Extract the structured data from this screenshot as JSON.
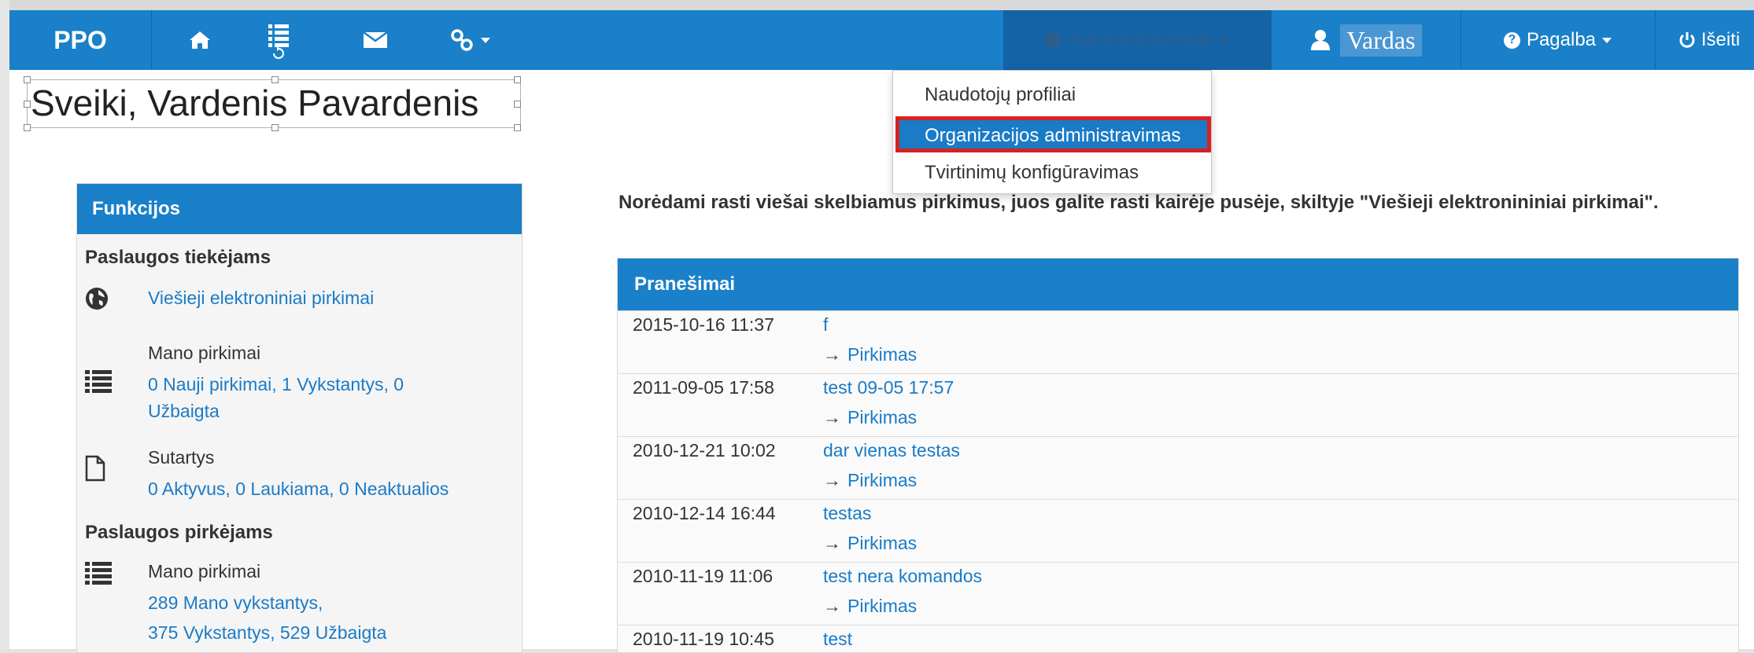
{
  "navbar": {
    "brand": "PPO",
    "home_icon": "home-icon",
    "list_icon": "list-icon",
    "mail_icon": "mail-icon",
    "links_icon": "link-icon",
    "admin_label": "Administravimas",
    "user_icon": "user-icon",
    "user_name": "Vardas",
    "help_icon": "question-circle-icon",
    "help_label": "Pagalba",
    "logout_icon": "power-icon",
    "logout_label": "Išeiti",
    "colors": {
      "bar": "#1a80c9",
      "active": "#1463a5"
    }
  },
  "greeting": "Sveiki, Vardenis Pavardenis",
  "dropdown": {
    "items": [
      {
        "label": "Naudotojų profiliai"
      },
      {
        "label": "Organizacijos administravimas",
        "active": true,
        "highlight_border": "#d62222"
      },
      {
        "label": "Tvirtinimų konfigūravimas"
      }
    ]
  },
  "notice": "Norėdami rasti viešai skelbiamus pirkimus, juos galite rasti kairėje pusėje, skiltyje \"Viešieji elektronininiai pirkimai\".",
  "functions": {
    "title": "Funkcijos",
    "suppliers_title": "Paslaugos tiekėjams",
    "public_link": "Viešieji elektroniniai pirkimai",
    "my_purchases_label": "Mano pirkimai",
    "my_purchases_line1": "0 Nauji pirkimai,  1 Vykstantys,  0",
    "my_purchases_line2": "Užbaigta",
    "contracts_label": "Sutartys",
    "contracts_line": "0 Aktyvus,  0 Laukiama,  0 Neaktualios",
    "buyers_title": "Paslaugos pirkėjams",
    "buyer_purchases_label": "Mano pirkimai",
    "buyer_line1": "289 Mano vykstantys,",
    "buyer_line2": "375 Vykstantys,  529 Užbaigta"
  },
  "notifications": {
    "title": "Pranešimai",
    "link_label": "Pirkimas",
    "rows": [
      {
        "date": "2015-10-16 11:37",
        "title": "f"
      },
      {
        "date": "2011-09-05 17:58",
        "title": "test 09-05 17:57"
      },
      {
        "date": "2010-12-21 10:02",
        "title": "dar vienas testas"
      },
      {
        "date": "2010-12-14 16:44",
        "title": "testas"
      },
      {
        "date": "2010-11-19 11:06",
        "title": "test nera komandos"
      },
      {
        "date": "2010-11-19 10:45",
        "title": "test"
      }
    ]
  }
}
